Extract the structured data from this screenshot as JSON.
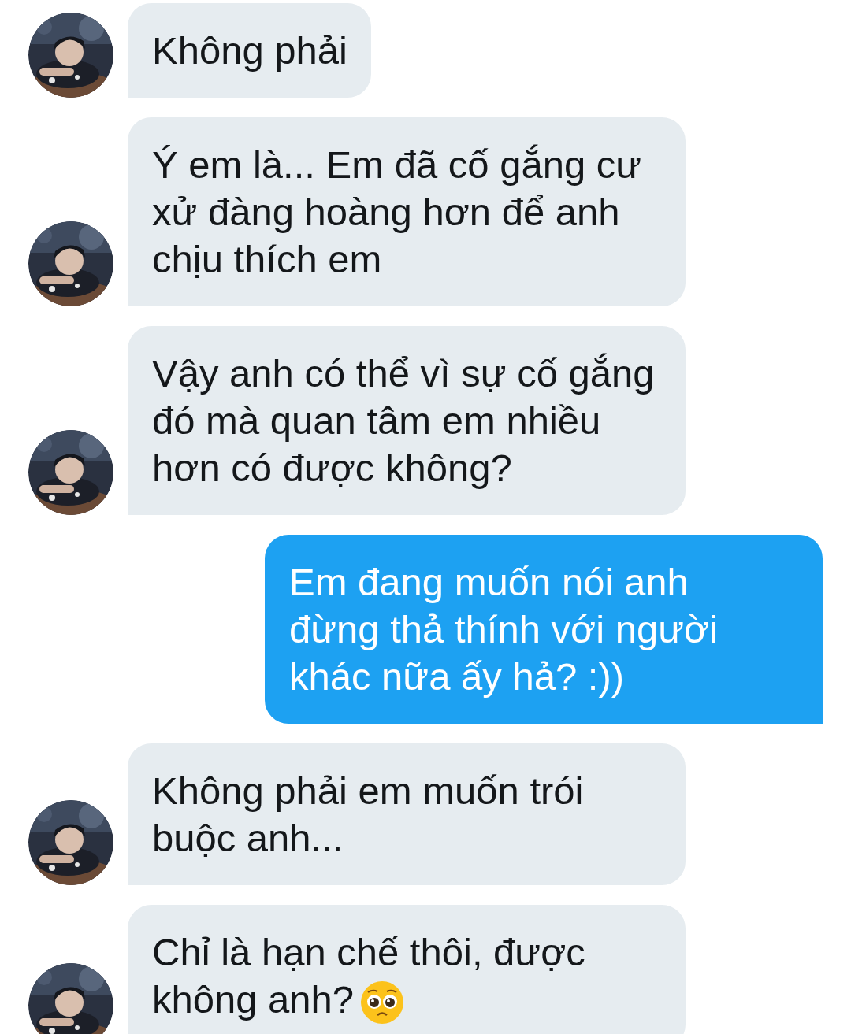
{
  "messages": [
    {
      "kind": "received",
      "text": "Không phải"
    },
    {
      "kind": "received",
      "text": "Ý em là... Em đã cố gắng cư xử đàng hoàng hơn để anh chịu thích em"
    },
    {
      "kind": "received",
      "text": "Vậy anh có thể vì sự cố gắng đó mà quan tâm em nhiều hơn có được không?"
    },
    {
      "kind": "sent",
      "text": "Em đang muốn nói anh đừng thả thính với người khác nữa ấy hả? :))"
    },
    {
      "kind": "received",
      "text": "Không phải em muốn trói buộc anh..."
    },
    {
      "kind": "received",
      "text": "Chỉ là hạn chế thôi, được không anh?",
      "emoji_icon": true
    }
  ]
}
